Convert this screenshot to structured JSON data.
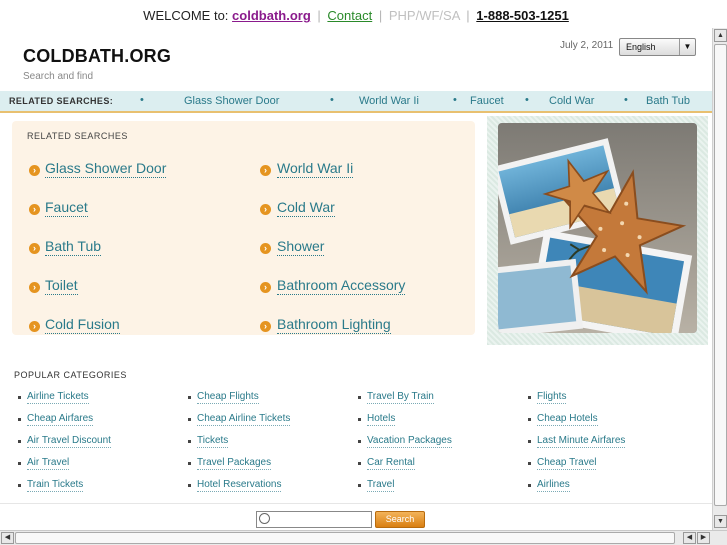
{
  "topbar": {
    "welcome": "WELCOME to:",
    "site": "coldbath.org",
    "sep": "|",
    "contact": "Contact",
    "tag": "PHP/WF/SA",
    "phone": "1-888-503-1251"
  },
  "header": {
    "logo": "COLDBATH.ORG",
    "tagline": "Search and find",
    "date": "July 2, 2011",
    "language": "English"
  },
  "related_bar": {
    "label": "RELATED SEARCHES:",
    "items": [
      "Glass Shower Door",
      "World War Ii",
      "Faucet",
      "Cold War",
      "Bath Tub"
    ]
  },
  "related_box": {
    "heading": "RELATED SEARCHES",
    "items": [
      "Glass Shower Door",
      "World War Ii",
      "Faucet",
      "Cold War",
      "Bath Tub",
      "Shower",
      "Toilet",
      "Bathroom Accessory",
      "Cold Fusion",
      "Bathroom Lighting"
    ]
  },
  "popular": {
    "heading": "POPULAR CATEGORIES",
    "items": [
      "Airline Tickets",
      "Cheap Flights",
      "Travel By Train",
      "Flights",
      "Cheap Airfares",
      "Cheap Airline Tickets",
      "Hotels",
      "Cheap Hotels",
      "Air Travel Discount",
      "Tickets",
      "Vacation Packages",
      "Last Minute Airfares",
      "Air Travel",
      "Travel Packages",
      "Car Rental",
      "Cheap Travel",
      "Train Tickets",
      "Hotel Reservations",
      "Travel",
      "Airlines"
    ]
  },
  "search": {
    "placeholder": "",
    "button": "Search"
  },
  "icons": {
    "search": "magnifier-icon",
    "bullet": "arrow-circle-icon",
    "dropdown": "chevron-down-icon"
  },
  "colors": {
    "accent": "#e59420",
    "link": "#2a7a8a",
    "bar": "#dceef0"
  }
}
